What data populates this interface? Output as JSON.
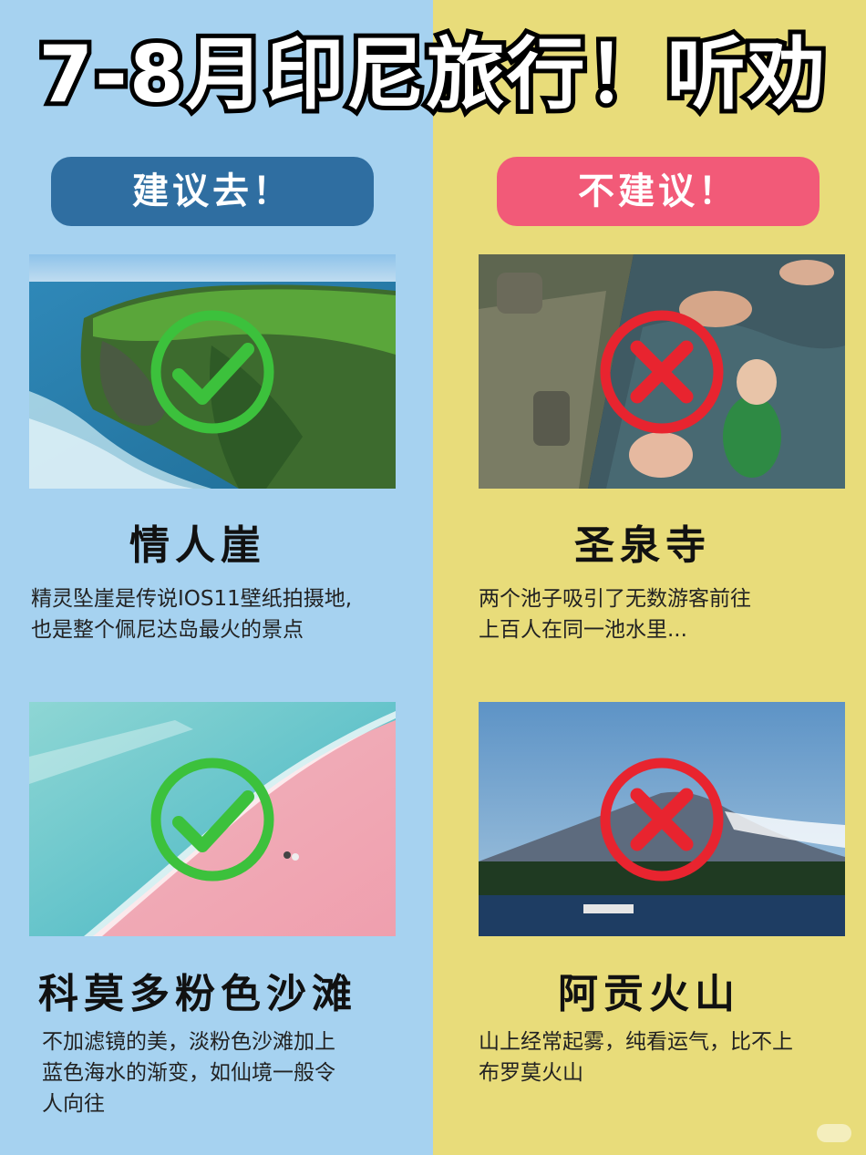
{
  "title": "7-8月印尼旅行！听劝",
  "columns": {
    "recommend": {
      "label": "建议去！",
      "color": "#2f6ea1",
      "items": [
        {
          "name": "情人崖",
          "desc_lines": [
            "精灵坠崖是传说IOS11壁纸拍摄地,",
            "也是整个佩尼达岛最火的景点"
          ],
          "mark_icon": "green-check-circle-icon"
        },
        {
          "name": "科莫多粉色沙滩",
          "desc_lines": [
            "不加滤镜的美，淡粉色沙滩加上",
            "蓝色海水的渐变，如仙境一般令",
            "人向往"
          ],
          "mark_icon": "green-check-circle-icon"
        }
      ]
    },
    "not_recommend": {
      "label": "不建议！",
      "color": "#f25a78",
      "items": [
        {
          "name": "圣泉寺",
          "desc_lines": [
            "两个池子吸引了无数游客前往",
            "上百人在同一池水里..."
          ],
          "mark_icon": "red-x-circle-icon"
        },
        {
          "name": "阿贡火山",
          "desc_lines": [
            "山上经常起雾，纯看运气，比不上",
            "布罗莫火山"
          ],
          "mark_icon": "red-x-circle-icon"
        }
      ]
    }
  },
  "colors": {
    "left_bg": "#a6d2f0",
    "right_bg": "#e8dc7a",
    "check": "#3cc13c",
    "cross": "#e8242f"
  }
}
